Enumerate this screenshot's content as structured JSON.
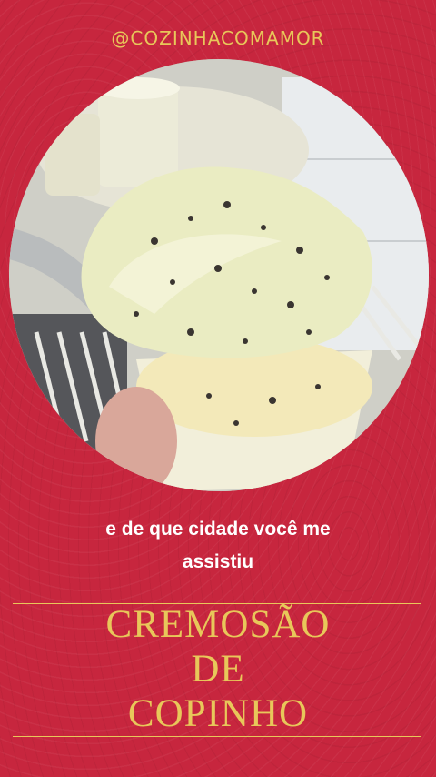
{
  "header": {
    "handle": "@COZINHACOMAMOR"
  },
  "photo": {
    "description_icon": "ice-cream-spoon-photo"
  },
  "caption": {
    "line1": "e de que cidade você me",
    "line2": "assistiu"
  },
  "title": {
    "line1": "CREMOSÃO",
    "line2": "DE",
    "line3": "COPINHO"
  },
  "colors": {
    "background": "#c7263e",
    "accent": "#e8c75a",
    "text": "#ffffff"
  }
}
